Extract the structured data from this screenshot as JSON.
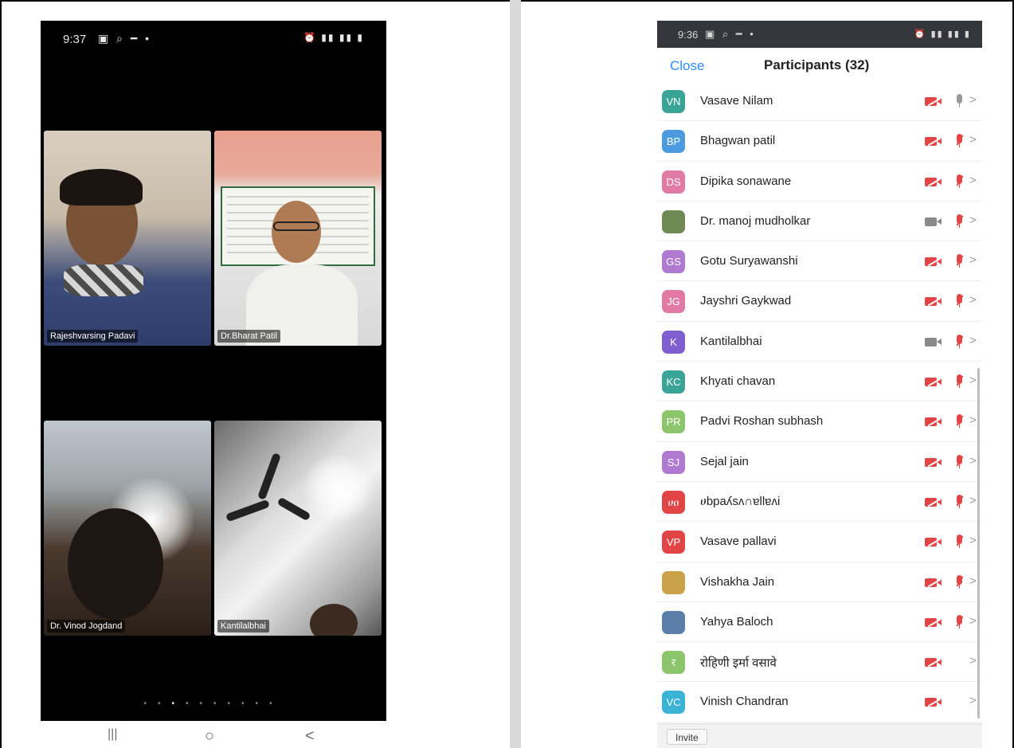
{
  "left_phone": {
    "status_time": "9:37",
    "tiles": [
      {
        "name": "Rajeshvarsing Padavi"
      },
      {
        "name": "Dr.Bharat Patil"
      },
      {
        "name": "Dr. Vinod Jogdand"
      },
      {
        "name": "Kantilalbhai"
      }
    ],
    "page_dots": [
      "•",
      "•",
      "•",
      "•",
      "•",
      "•",
      "•",
      "•",
      "•",
      "•"
    ],
    "active_dot_index": 2,
    "nav": {
      "recent": "|||",
      "home": "○",
      "back": "<"
    }
  },
  "right_phone": {
    "status_time": "9:36",
    "header": {
      "close_label": "Close",
      "title": "Participants (32)"
    },
    "participants": [
      {
        "initials": "VN",
        "name": "Vasave Nilam",
        "color": "#3aa597",
        "video": "off",
        "mic": "unmuted"
      },
      {
        "initials": "BP",
        "name": "Bhagwan patil",
        "color": "#4c9be0",
        "video": "off",
        "mic": "muted"
      },
      {
        "initials": "DS",
        "name": "Dipika sonawane",
        "color": "#e27aa6",
        "video": "off",
        "mic": "muted"
      },
      {
        "initials": "",
        "name": "Dr. manoj mudholkar",
        "color": "#6f8a55",
        "video": "on",
        "mic": "muted"
      },
      {
        "initials": "GS",
        "name": "Gotu Suryawanshi",
        "color": "#b07ad1",
        "video": "off",
        "mic": "muted"
      },
      {
        "initials": "JG",
        "name": "Jayshri Gaykwad",
        "color": "#e27aa6",
        "video": "off",
        "mic": "muted"
      },
      {
        "initials": "K",
        "name": "Kantilalbhai",
        "color": "#7e5fd0",
        "video": "on",
        "mic": "muted"
      },
      {
        "initials": "KC",
        "name": "Khyati chavan",
        "color": "#3aa597",
        "video": "off",
        "mic": "muted"
      },
      {
        "initials": "PR",
        "name": "Padvi Roshan subhash",
        "color": "#8cc56b",
        "video": "off",
        "mic": "muted"
      },
      {
        "initials": "SJ",
        "name": "Sejal jain",
        "color": "#b07ad1",
        "video": "off",
        "mic": "muted"
      },
      {
        "initials": "ሀዐ",
        "name": "ሀbpaʎsʌ∩ɐllɐʌi",
        "color": "#e24545",
        "video": "off",
        "mic": "muted"
      },
      {
        "initials": "VP",
        "name": "Vasave pallavi",
        "color": "#e24545",
        "video": "off",
        "mic": "muted"
      },
      {
        "initials": "",
        "name": "Vishakha Jain",
        "color": "#c9a24a",
        "video": "off",
        "mic": "muted"
      },
      {
        "initials": "",
        "name": "Yahya Baloch",
        "color": "#5b7fa8",
        "video": "off",
        "mic": "muted"
      },
      {
        "initials": "र",
        "name": "रोहिणी इर्मा वसावे",
        "color": "#8cc56b",
        "video": "off",
        "mic": "none"
      },
      {
        "initials": "VC",
        "name": "Vinish Chandran",
        "color": "#3ab3d6",
        "video": "off",
        "mic": "none"
      }
    ],
    "footer": {
      "invite_label": "Invite"
    }
  }
}
